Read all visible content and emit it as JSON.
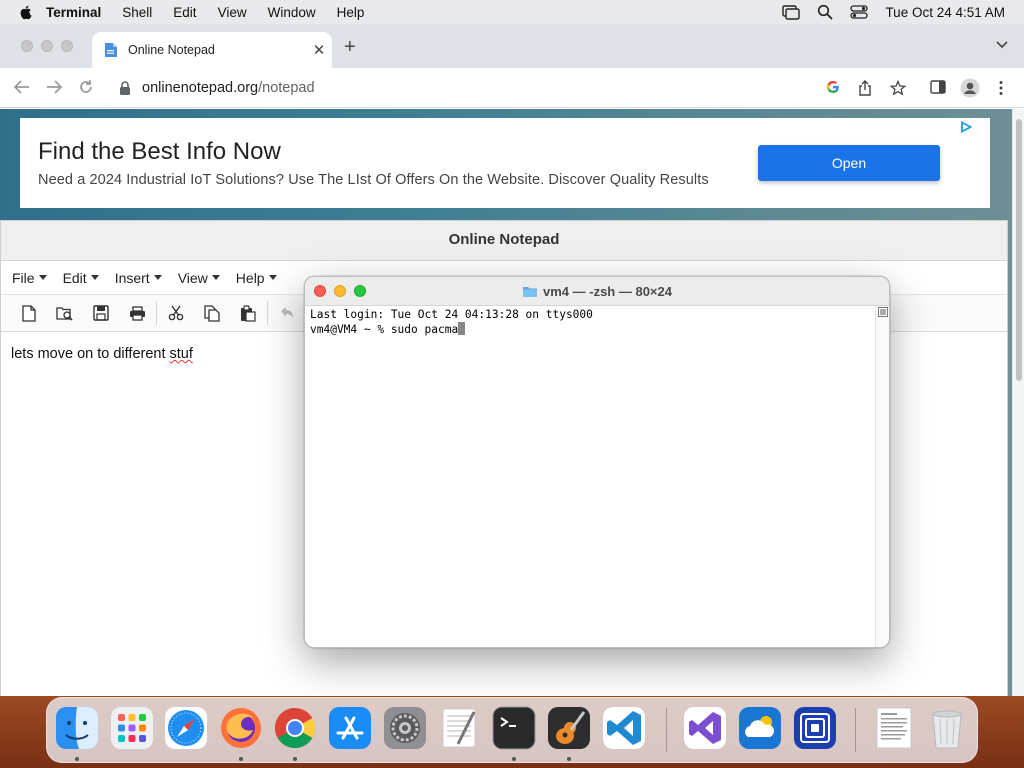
{
  "menubar": {
    "app_name": "Terminal",
    "items": [
      "Shell",
      "Edit",
      "View",
      "Window",
      "Help"
    ],
    "clock": "Tue Oct 24  4:51 AM"
  },
  "browser": {
    "tab_title": "Online Notepad",
    "url_domain": "onlinenotepad.org",
    "url_path": "/notepad"
  },
  "ad": {
    "headline": "Find the Best Info Now",
    "description": "Need a 2024 Industrial IoT Solutions? Use The LIst Of Offers On the Website. Discover Quality Results",
    "button_label": "Open"
  },
  "notepad": {
    "title": "Online Notepad",
    "menu": [
      "File",
      "Edit",
      "Insert",
      "View",
      "Help"
    ],
    "text_before": "lets move on to different ",
    "text_misspelled": "stuf"
  },
  "terminal": {
    "title": "vm4 — -zsh — 80×24",
    "lines": [
      "Last login: Tue Oct 24 04:13:28 on ttys000",
      "vm4@VM4 ~ % sudo pacma"
    ]
  },
  "dock": {
    "apps": [
      "Finder",
      "Launchpad",
      "Safari",
      "Firefox",
      "Google Chrome",
      "App Store",
      "System Settings",
      "TextEdit",
      "Terminal",
      "GarageBand",
      "Visual Studio Code",
      "Visual Studio",
      "Cloud App",
      "Remote Desktop",
      "Document",
      "Trash"
    ]
  },
  "colors": {
    "accent_blue": "#1a73e8",
    "traffic_red": "#fe5f57",
    "traffic_yellow": "#febc2e",
    "traffic_green": "#28c840"
  }
}
